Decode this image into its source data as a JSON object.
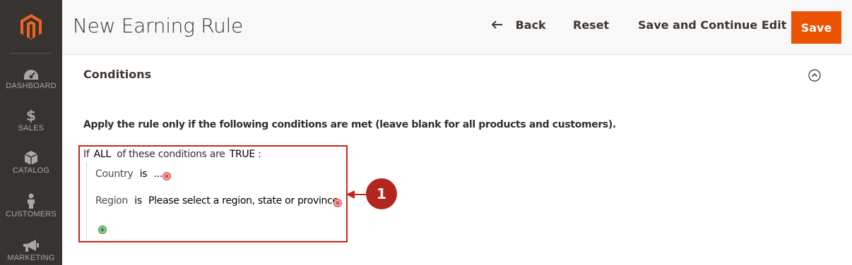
{
  "sidebar": {
    "items": [
      {
        "label": "DASHBOARD",
        "icon": "dashboard-icon"
      },
      {
        "label": "SALES",
        "icon": "dollar-icon"
      },
      {
        "label": "CATALOG",
        "icon": "box-icon"
      },
      {
        "label": "CUSTOMERS",
        "icon": "person-icon"
      },
      {
        "label": "MARKETING",
        "icon": "megaphone-icon"
      }
    ]
  },
  "header": {
    "title": "New Earning Rule",
    "back_label": "Back",
    "reset_label": "Reset",
    "save_continue_label": "Save and Continue Edit",
    "save_label": "Save"
  },
  "section": {
    "title": "Conditions",
    "apply_text": "Apply the rule only if the following conditions are met (leave blank for all products and customers)."
  },
  "conditions": {
    "if_text": "If",
    "aggregator": "ALL",
    "of_text": "of these conditions are",
    "value": "TRUE",
    "colon": ":",
    "rows": [
      {
        "attribute": "Country",
        "operator": "is",
        "value": "..."
      },
      {
        "attribute": "Region",
        "operator": "is",
        "value": "Please select a region, state or province."
      }
    ]
  },
  "callout": {
    "number": "1"
  },
  "colors": {
    "accent": "#eb5202",
    "sidebar_bg": "#373330",
    "callout": "#c4281c"
  }
}
